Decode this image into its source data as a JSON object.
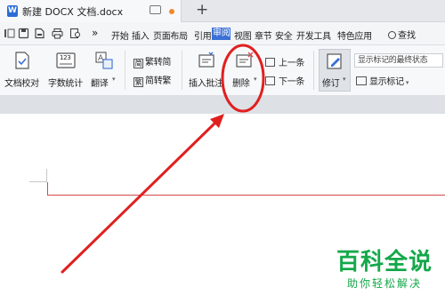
{
  "tab": {
    "app_icon_letter": "W",
    "title": "新建 DOCX 文档.docx",
    "new_tab_symbol": "+"
  },
  "menu": {
    "overflow_symbol": "»",
    "items": [
      "开始",
      "插入",
      "页面布局",
      "引用",
      "审阅",
      "视图",
      "章节",
      "安全",
      "开发工具",
      "特色应用"
    ],
    "active_item": "审阅",
    "search_label": "查找"
  },
  "ribbon": {
    "doc_proof_label": "文档校对",
    "word_count_label": "字数统计",
    "word_count_icon_text": "123",
    "translate_label": "翻译",
    "trad_to_simp_label": "繁转简",
    "simp_to_trad_label": "简转繁",
    "insert_comment_label": "插入批注",
    "delete_label": "删除",
    "prev_label": "上一条",
    "next_label": "下一条",
    "revise_label": "修订",
    "markup_mode_value": "显示标记的最终状态",
    "show_markup_label": "显示标记"
  },
  "watermark": {
    "main_text": "百科全说",
    "sub_text": "助你轻松解决"
  },
  "annotation": {
    "color": "#e02020"
  },
  "colors": {
    "accent": "#3b70d6",
    "watermark": "#14a84a",
    "margin_line": "#d54a4a"
  }
}
